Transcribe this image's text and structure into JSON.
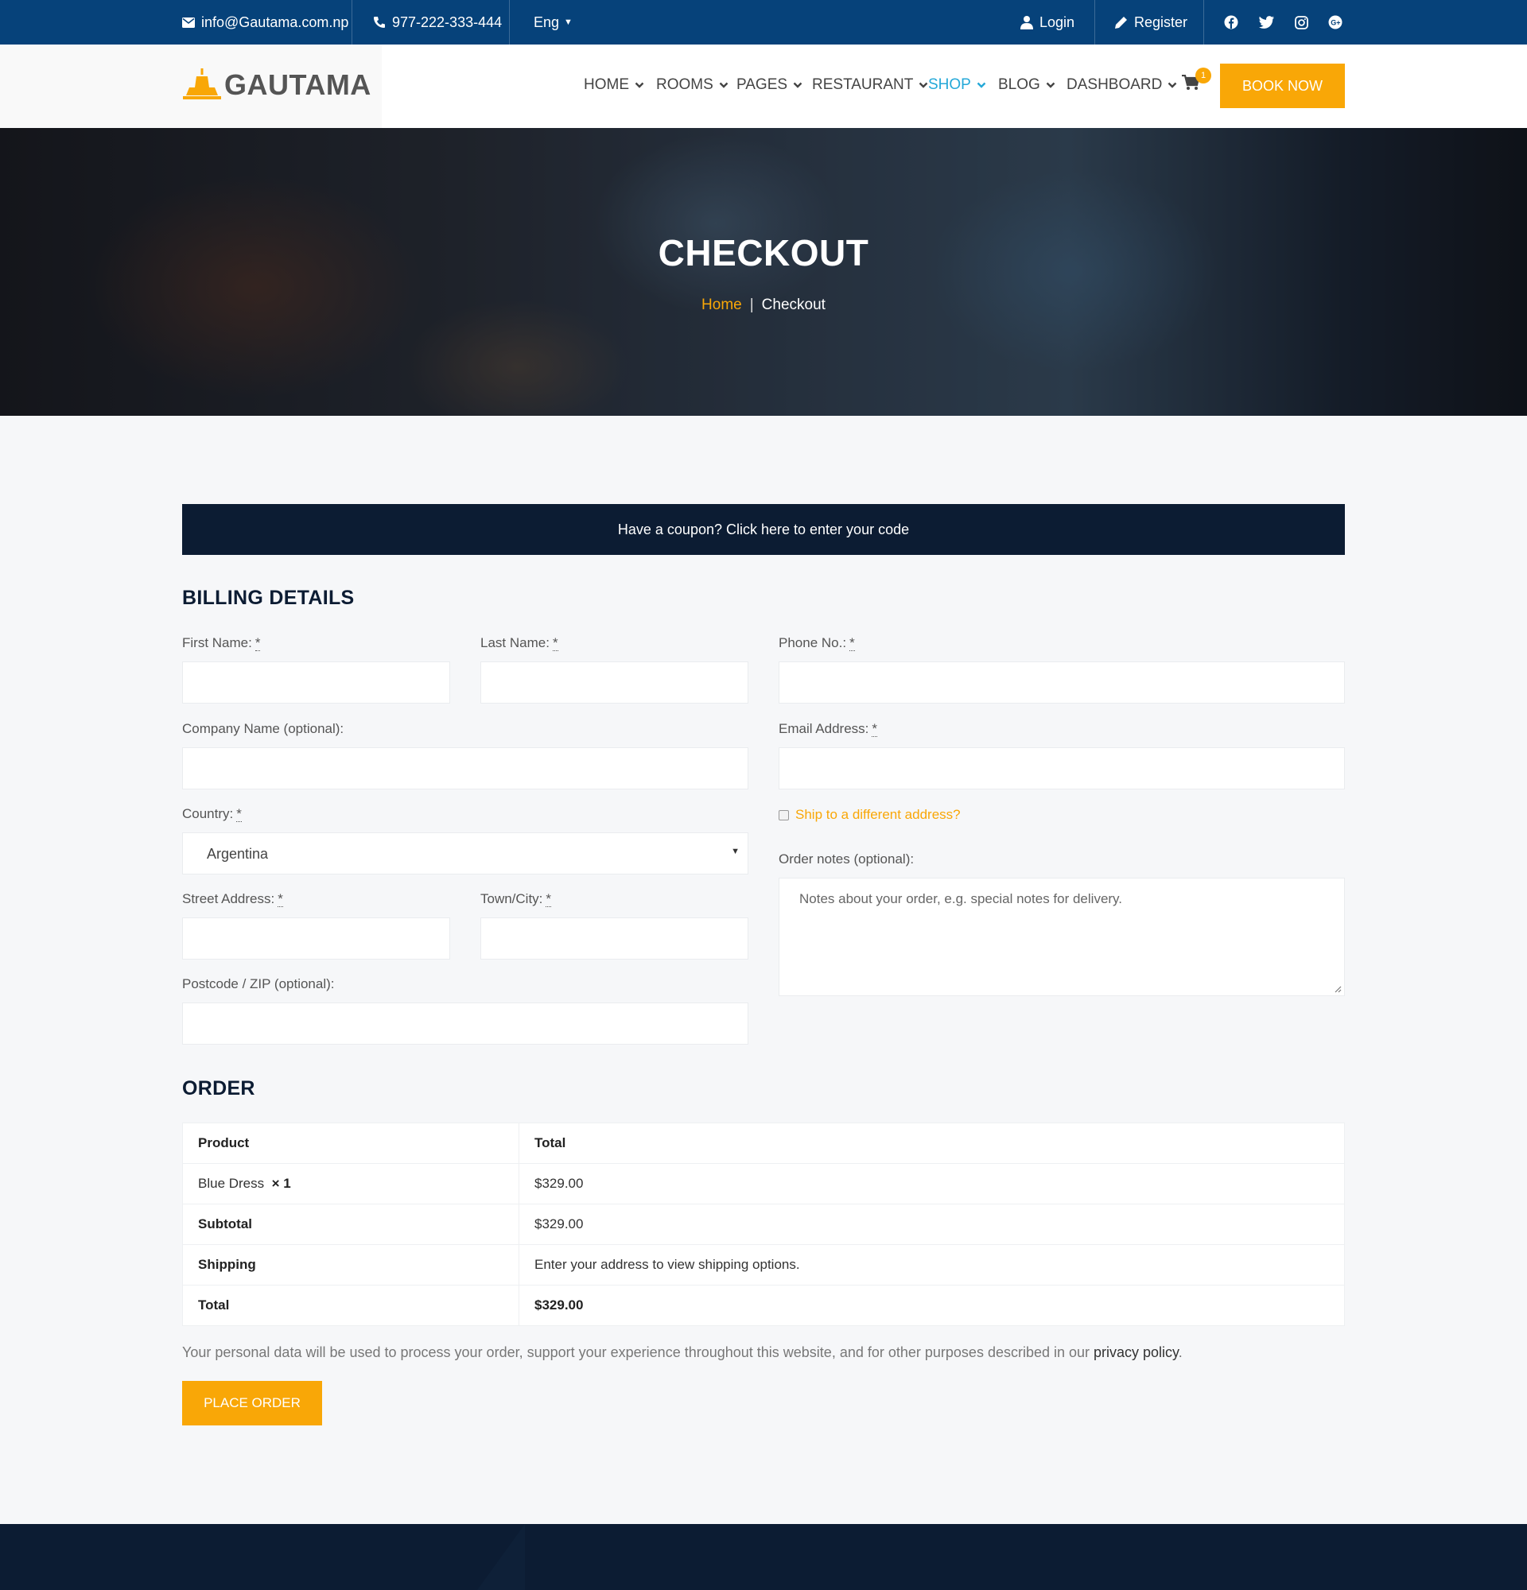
{
  "topbar": {
    "email": "info@Gautama.com.np",
    "phone": "977-222-333-444",
    "language": "Eng",
    "login": "Login",
    "register": "Register",
    "social_icons": [
      "facebook-icon",
      "twitter-icon",
      "instagram-icon",
      "google-plus-icon"
    ]
  },
  "header": {
    "logo_text": "GAUTAMA",
    "nav": [
      {
        "label": "HOME"
      },
      {
        "label": "ROOMS"
      },
      {
        "label": "PAGES"
      },
      {
        "label": "RESTAURANT"
      },
      {
        "label": "SHOP"
      },
      {
        "label": "BLOG"
      },
      {
        "label": "DASHBOARD"
      }
    ],
    "active_nav": "SHOP",
    "cart_count": "1",
    "book_now": "BOOK NOW"
  },
  "hero": {
    "title": "CHECKOUT",
    "breadcrumb_home": "Home",
    "breadcrumb_sep": "|",
    "breadcrumb_current": "Checkout"
  },
  "coupon": {
    "text": "Have a coupon? Click here to enter your code"
  },
  "billing": {
    "heading": "BILLING DETAILS",
    "required_mark": "*",
    "first_name_label": "First Name:",
    "last_name_label": "Last Name:",
    "phone_label": "Phone No.:",
    "company_label": "Company Name (optional):",
    "email_label": "Email Address:",
    "country_label": "Country:",
    "country_value": "Argentina",
    "ship_different": "Ship to a different address?",
    "street_label": "Street Address:",
    "town_label": "Town/City:",
    "notes_label": "Order notes (optional):",
    "notes_placeholder": "Notes about your order, e.g. special notes for delivery.",
    "postcode_label": "Postcode / ZIP (optional):"
  },
  "order": {
    "heading": "ORDER",
    "col_product": "Product",
    "col_total": "Total",
    "item_name": "Blue Dress",
    "item_qty": "× 1",
    "item_price": "$329.00",
    "subtotal_label": "Subtotal",
    "subtotal_value": "$329.00",
    "shipping_label": "Shipping",
    "shipping_value": "Enter your address to view shipping options.",
    "total_label": "Total",
    "total_value": "$329.00",
    "privacy_text": "Your personal data will be used to process your order, support your experience throughout this website, and for other purposes described in our ",
    "privacy_link": "privacy policy",
    "privacy_end": ".",
    "place_order": "PLACE ORDER"
  },
  "colors": {
    "topbar": "#06427a",
    "accent": "#f9a707",
    "dark": "#0c1c33",
    "price": "#d4274e",
    "active_nav": "#24a8d8"
  }
}
